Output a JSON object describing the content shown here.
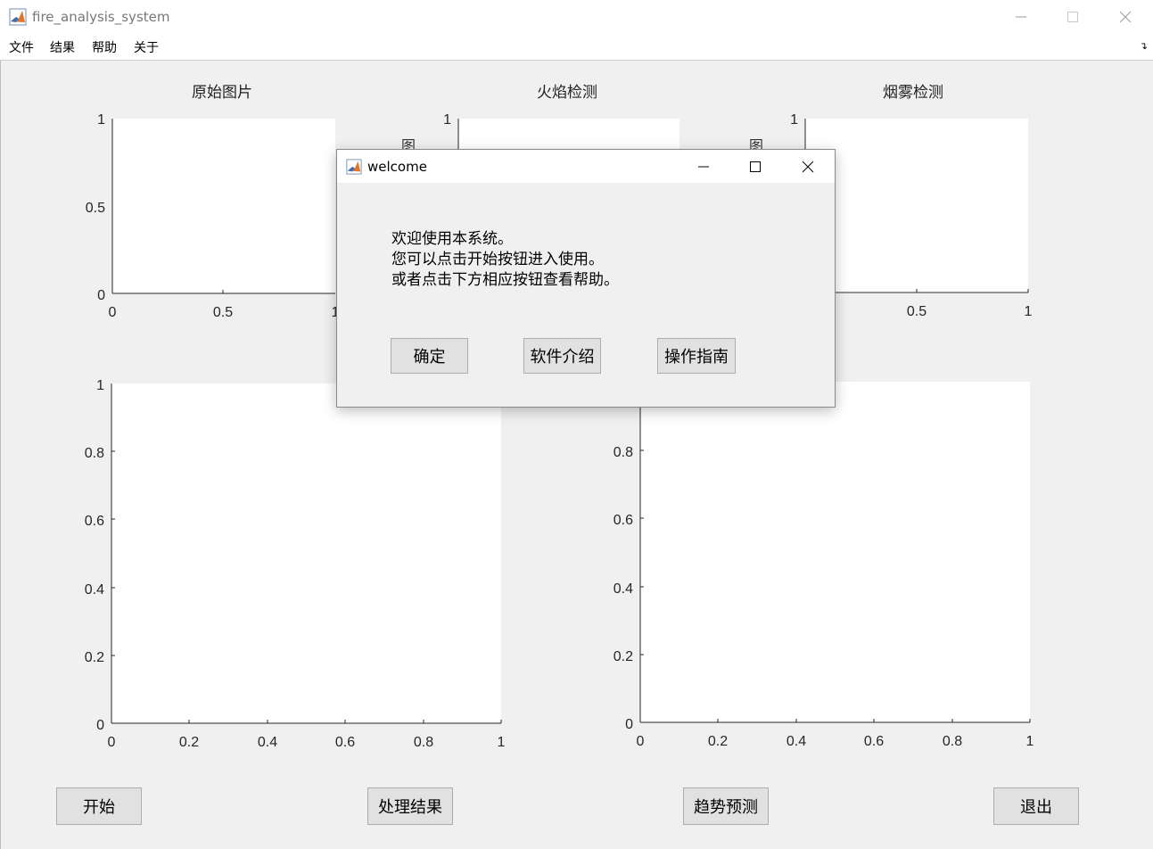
{
  "window": {
    "title": "fire_analysis_system"
  },
  "menu": [
    "文件",
    "结果",
    "帮助",
    "关于"
  ],
  "axes": {
    "original_title": "原始图片",
    "flame_title": "火焰检测",
    "smoke_title": "烟雾检测",
    "ylabel_fragment": "图",
    "small_ticks": [
      "0",
      "0.5",
      "1"
    ],
    "large_ticks": [
      "0",
      "0.2",
      "0.4",
      "0.6",
      "0.8",
      "1"
    ]
  },
  "buttons": {
    "start": "开始",
    "process_result": "处理结果",
    "trend_predict": "趋势预测",
    "exit": "退出"
  },
  "dialog": {
    "title": "welcome",
    "message_lines": [
      "欢迎使用本系统。",
      "您可以点击开始按钮进入使用。",
      "或者点击下方相应按钮查看帮助。"
    ],
    "ok": "确定",
    "software_intro": "软件介绍",
    "operation_guide": "操作指南"
  }
}
